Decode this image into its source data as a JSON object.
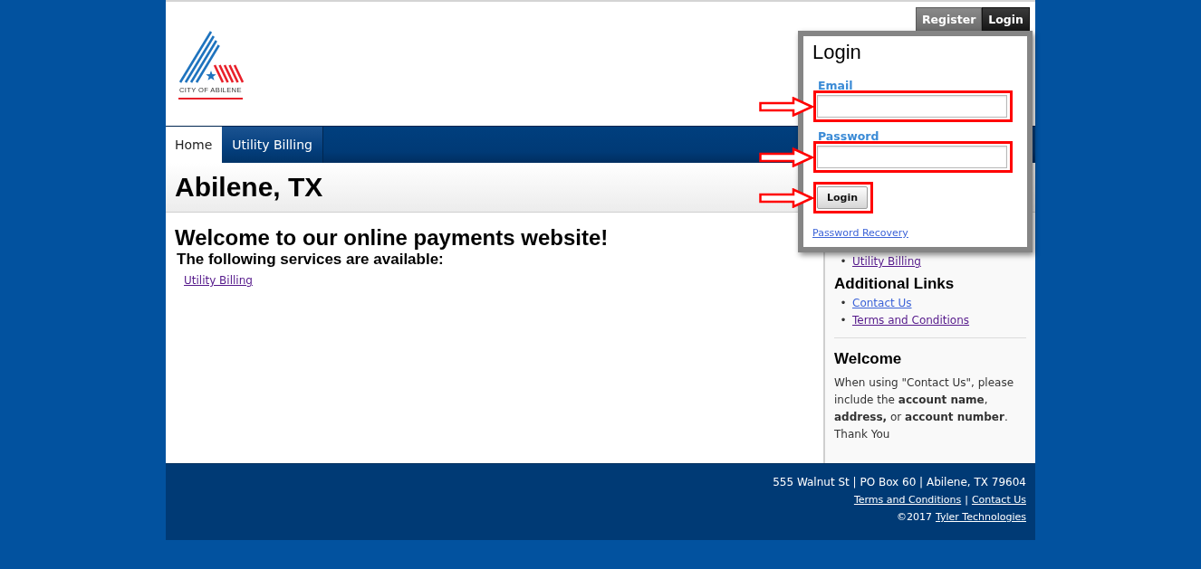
{
  "header": {
    "logo": {
      "text": "CITY OF ABILENE"
    },
    "account_tabs": [
      {
        "label": "Register",
        "selected": false
      },
      {
        "label": "Login",
        "selected": true
      }
    ]
  },
  "login_popup": {
    "title": "Login",
    "fields": [
      {
        "label": "Email",
        "highlighted": true
      },
      {
        "label": "Password",
        "highlighted": true
      }
    ],
    "submit": {
      "label": "Login",
      "highlighted": true
    },
    "recovery_link": "Password Recovery"
  },
  "nav": {
    "tabs": [
      {
        "label": "Home",
        "selected": true
      },
      {
        "label": "Utility Billing",
        "selected": false
      }
    ]
  },
  "page_title": "Abilene, TX",
  "main": {
    "heading": "Welcome to our online payments website!",
    "subheading": "The following services are available:",
    "links": [
      {
        "label": "Utility Billing",
        "visited": true
      }
    ]
  },
  "sidebar": {
    "services": [
      {
        "marker": "•",
        "label": "Utility Billing",
        "visited": true
      }
    ],
    "additional_links": {
      "title": "Additional Links",
      "links": [
        {
          "marker": "•",
          "label": "Contact Us",
          "visited": false
        },
        {
          "marker": "•",
          "label": "Terms and Conditions",
          "visited": true
        }
      ]
    },
    "welcome": {
      "title": "Welcome",
      "text": "When using \"Contact Us\", please include the **account name**, **address,** or **account number**. Thank You"
    }
  },
  "footer": {
    "address": "555 Walnut St | PO Box 60 | Abilene, TX 79604",
    "links": [
      {
        "label": "Terms and Conditions"
      },
      {
        "label": "Contact Us"
      }
    ],
    "separator": "|",
    "copyright": "©2017",
    "credit_link": "Tyler Technologies"
  }
}
